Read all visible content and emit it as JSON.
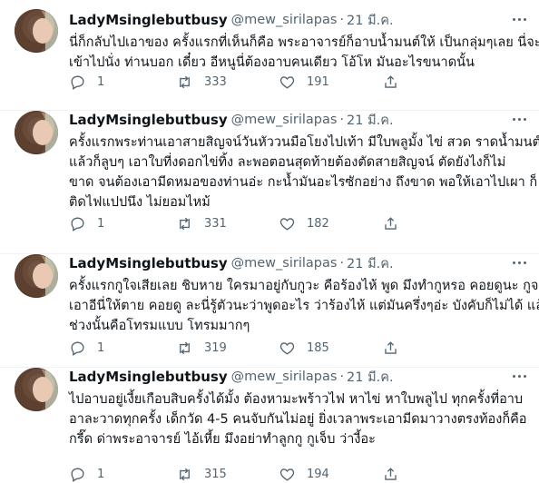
{
  "tweets": [
    {
      "name": "LadyMsinglebutbusy",
      "handle": "@mew_sirilapas",
      "dot": "·",
      "date": "21 มี.ค.",
      "lines": [
        "นี่ก็กลับไปเอาของ ครั้งแรกที่เห็นก็คือ พระอาจารย์ก็อาบน้ำมนต์ให้ เป็นกลุ่มๆเลย นี่จะ",
        "เข้าไปนั่ง ท่านบอก เดี๋ยว อีหนูนี่ต้องอาบคนเดียว โอ้โห มันอะไรขนาดนั้น"
      ],
      "reply_count": "1",
      "retweet_count": "333",
      "like_count": "191"
    },
    {
      "name": "LadyMsinglebutbusy",
      "handle": "@mew_sirilapas",
      "dot": "·",
      "date": "21 มี.ค.",
      "lines": [
        "ครั้งแรกพระท่านเอาสายสิญจน์วันหัววนมือโยงไปเท้า มีใบพลูมั้ง ไข่ สวด ราดน้ำมนต์",
        "แล้วก็ลูบๆ เอาใบที่งดอกไข่ทิ้ง ละพอตอนสุดท้ายต้องตัดสายสิญจน์ ตัดยังไงก็ไม่",
        "ขาด จนต้องเอามีดหมอของท่านอ่ะ กะน้ำมันอะไรซักอย่าง ถึงขาด พอให้เอาไปเผา ก็",
        "ติดไฟแปปนึง ไม่ยอมไหม้"
      ],
      "reply_count": "1",
      "retweet_count": "331",
      "like_count": "182"
    },
    {
      "name": "LadyMsinglebutbusy",
      "handle": "@mew_sirilapas",
      "dot": "·",
      "date": "21 มี.ค.",
      "lines": [
        "ครั้งแรกกูใจเสียเลย ชิบหาย ใครมาอยู่กับกูวะ คือร้องไห้ พูด มึงทำกูหรอ คอยดูนะ กูจะ",
        "เอาอีนี่ให้ตาย คอยดู ละนี่รู้ตัวนะว่าพูดอะไร ว่าร้องไห้ แต่มันครึ่งๆอ่ะ บังคับก็ไม่ได้ แล้ว",
        "ช่วงนั้นคือโทรมแบบ โทรมมากๆ"
      ],
      "reply_count": "1",
      "retweet_count": "319",
      "like_count": "185"
    },
    {
      "name": "LadyMsinglebutbusy",
      "handle": "@mew_sirilapas",
      "dot": "·",
      "date": "21 มี.ค.",
      "lines": [
        "ไปอาบอยู่เงี้ยเกือบสิบครั้งได้มั้ง ต้องหามะพร้าวไฟ หาไข่ หาใบพลูไป ทุกครั้งที่อาบ",
        "อาละวาดทุกครั้ง เด็กวัด 4-5 คนจับกันไม่อยู่ ยิ่งเวลาพระเอามีดมาวางตรงท้องก็คือ",
        "กรี๊ด ด่าพระอาจารย์ ไอ้เหี้ย มึงอย่าทำลูกกู กูเจ็บ ว่างี้อะ"
      ],
      "reply_count": "1",
      "retweet_count": "315",
      "like_count": "194"
    }
  ],
  "icons": {
    "reply": "reply-icon",
    "retweet": "retweet-icon",
    "like": "heart-icon",
    "share": "share-icon",
    "more": "more-icon"
  },
  "colors": {
    "text": "#0f1419",
    "muted": "#536471",
    "separator": "#eff3f4"
  }
}
